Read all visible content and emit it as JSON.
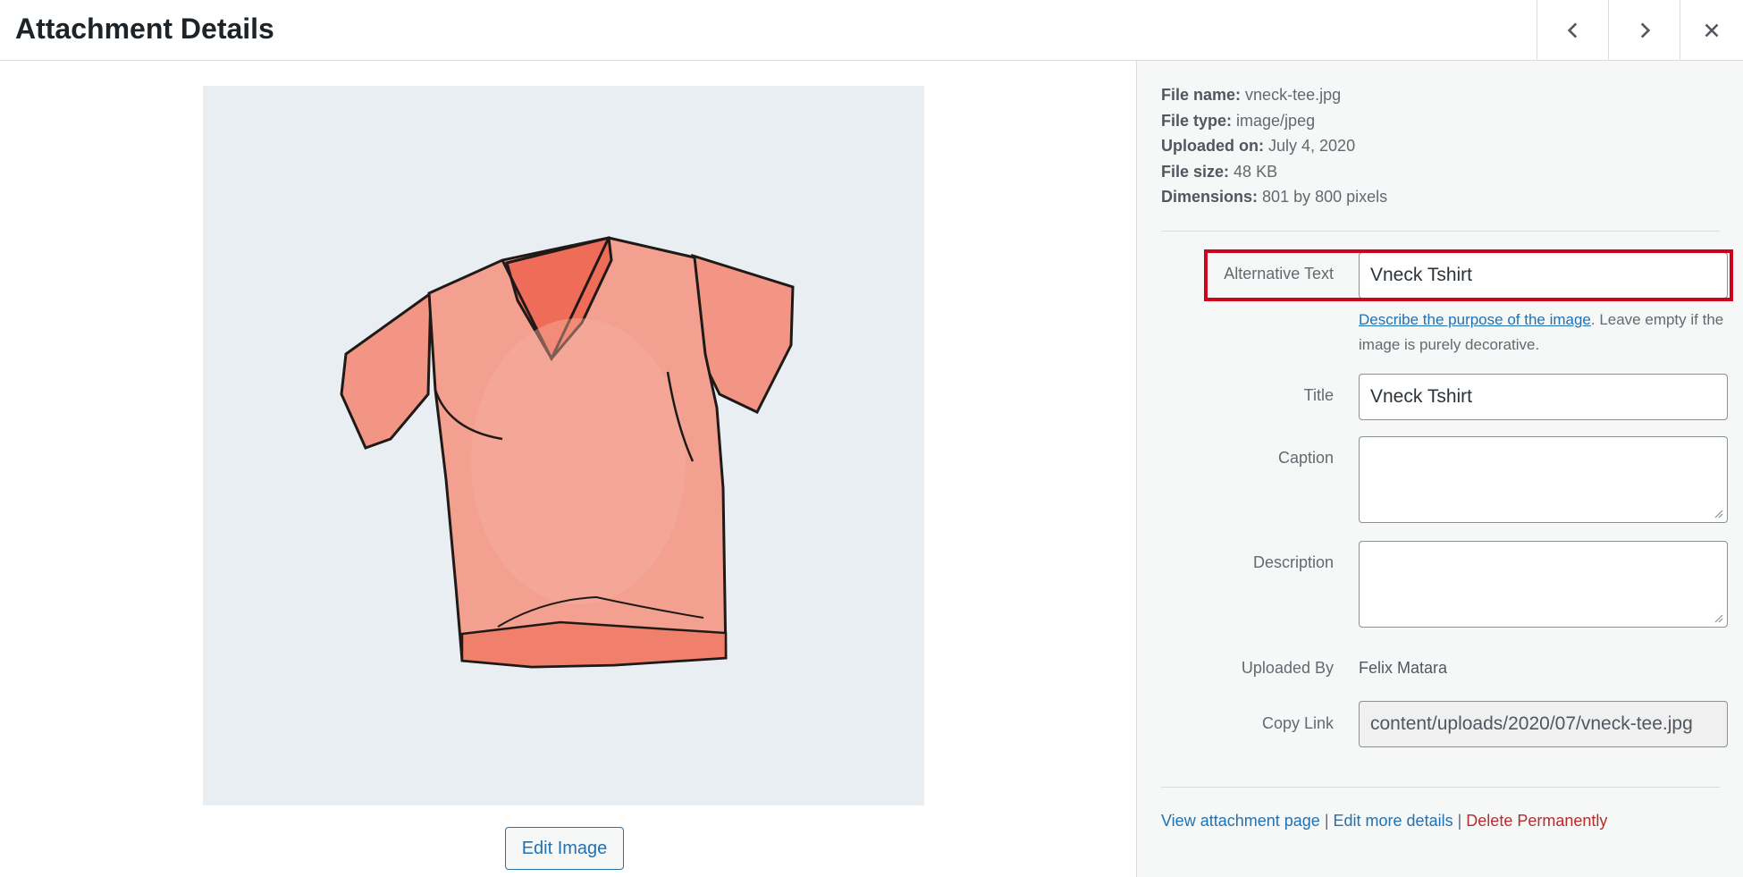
{
  "header": {
    "title": "Attachment Details",
    "prev_icon": "chevron-left-icon",
    "next_icon": "chevron-right-icon",
    "close_icon": "close-icon"
  },
  "media": {
    "edit_button_label": "Edit Image"
  },
  "details": {
    "file_name_label": "File name:",
    "file_name": "vneck-tee.jpg",
    "file_type_label": "File type:",
    "file_type": "image/jpeg",
    "uploaded_on_label": "Uploaded on:",
    "uploaded_on": "July 4, 2020",
    "file_size_label": "File size:",
    "file_size": "48 KB",
    "dimensions_label": "Dimensions:",
    "dimensions": "801 by 800 pixels"
  },
  "form": {
    "alt_label": "Alternative Text",
    "alt_value": "Vneck Tshirt",
    "alt_help_link": "Describe the purpose of the image",
    "alt_help_rest": ". Leave empty if the image is purely decorative.",
    "title_label": "Title",
    "title_value": "Vneck Tshirt",
    "caption_label": "Caption",
    "caption_value": "",
    "description_label": "Description",
    "description_value": "",
    "uploaded_by_label": "Uploaded By",
    "uploaded_by": "Felix Matara",
    "copy_link_label": "Copy Link",
    "copy_link_value": "content/uploads/2020/07/vneck-tee.jpg"
  },
  "actions": {
    "view_page": "View attachment page",
    "edit_details": "Edit more details",
    "delete": "Delete Permanently",
    "separator": "|"
  },
  "colors": {
    "accent": "#2271b1",
    "danger": "#b32d2e",
    "highlight": "#d0021b",
    "shirt": "#f4a090"
  }
}
